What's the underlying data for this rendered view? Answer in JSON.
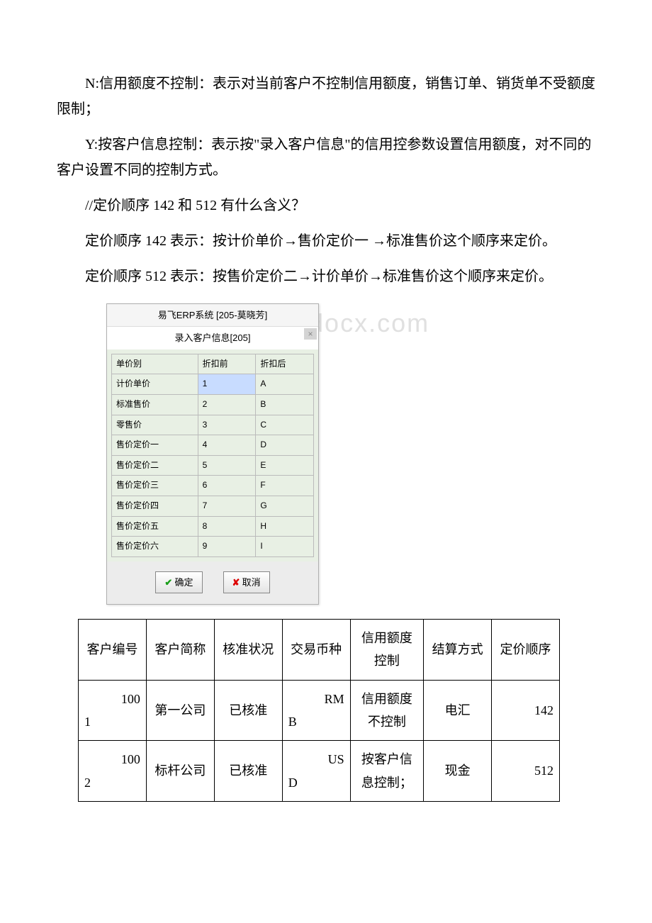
{
  "para1": "N:信用额度不控制：表示对当前客户不控制信用额度，销售订单、销货单不受额度限制；",
  "para2": "Y:按客户信息控制：表示按\"录入客户信息\"的信用控参数设置信用额度，对不同的客户设置不同的控制方式。",
  "para3": "//定价顺序 142 和 512 有什么含义？",
  "para4": "定价顺序 142 表示：按计价单价→售价定价一 →标准售价这个顺序来定价。",
  "para5": "定价顺序 512 表示：按售价定价二→计价单价→标准售价这个顺序来定价。",
  "dialog": {
    "title1": "易飞ERP系统 [205-莫晓芳]",
    "title2": "录入客户信息[205]",
    "headers": {
      "c0": "单价别",
      "c1": "折扣前",
      "c2": "折扣后"
    },
    "rows": [
      {
        "c0": "计价单价",
        "c1": "1",
        "c2": "A"
      },
      {
        "c0": "标准售价",
        "c1": "2",
        "c2": "B"
      },
      {
        "c0": "零售价",
        "c1": "3",
        "c2": "C"
      },
      {
        "c0": "售价定价一",
        "c1": "4",
        "c2": "D"
      },
      {
        "c0": "售价定价二",
        "c1": "5",
        "c2": "E"
      },
      {
        "c0": "售价定价三",
        "c1": "6",
        "c2": "F"
      },
      {
        "c0": "售价定价四",
        "c1": "7",
        "c2": "G"
      },
      {
        "c0": "售价定价五",
        "c1": "8",
        "c2": "H"
      },
      {
        "c0": "售价定价六",
        "c1": "9",
        "c2": "I"
      }
    ],
    "ok_label": "确定",
    "cancel_label": "取消"
  },
  "watermark": "www.bdocx.com",
  "table": {
    "headers": {
      "h0": "客户编号",
      "h1": "客户简称",
      "h2": "核准状况",
      "h3": "交易币种",
      "h4": "信用额度控制",
      "h5": "结算方式",
      "h6": "定价顺序"
    },
    "rows": [
      {
        "c0a": "100",
        "c0b": "1",
        "c1": "第一公司",
        "c2": "已核准",
        "c3a": "RM",
        "c3b": "B",
        "c4": "信用额度不控制",
        "c5": "电汇",
        "c6": "142"
      },
      {
        "c0a": "100",
        "c0b": "2",
        "c1": "标杆公司",
        "c2": "已核准",
        "c3a": "US",
        "c3b": "D",
        "c4": "按客户信息控制；",
        "c5": "现金",
        "c6": "512"
      }
    ]
  }
}
